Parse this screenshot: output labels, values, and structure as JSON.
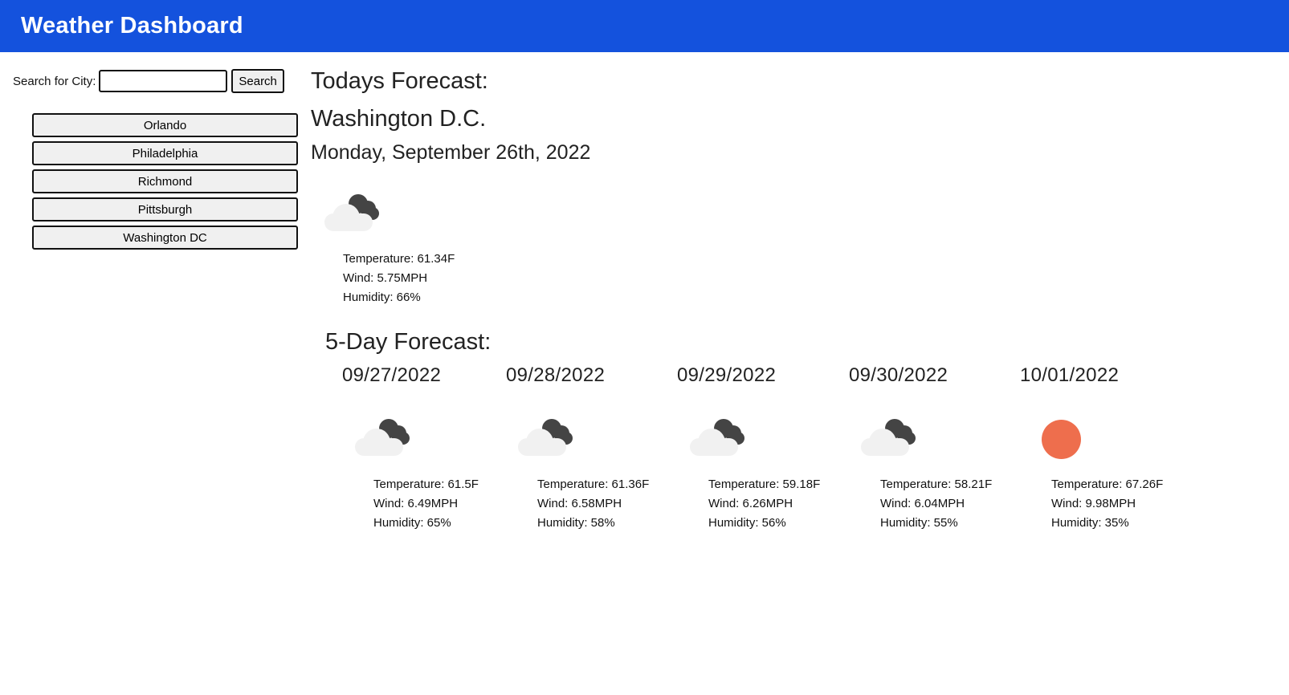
{
  "header": {
    "title": "Weather Dashboard"
  },
  "search": {
    "label": "Search for City:",
    "value": "",
    "button_label": "Search"
  },
  "history": [
    "Orlando",
    "Philadelphia",
    "Richmond",
    "Pittsburgh",
    "Washington DC"
  ],
  "today": {
    "heading": "Todays Forecast:",
    "city": "Washington D.C.",
    "date": "Monday, September 26th, 2022",
    "icon": "cloud-icon",
    "temperature": "Temperature: 61.34F",
    "wind": "Wind: 5.75MPH",
    "humidity": "Humidity: 66%"
  },
  "five_day": {
    "heading": "5-Day Forecast:",
    "days": [
      {
        "date": "09/27/2022",
        "icon": "cloud-icon",
        "temperature": "Temperature: 61.5F",
        "wind": "Wind: 6.49MPH",
        "humidity": "Humidity: 65%"
      },
      {
        "date": "09/28/2022",
        "icon": "cloud-icon",
        "temperature": "Temperature: 61.36F",
        "wind": "Wind: 6.58MPH",
        "humidity": "Humidity: 58%"
      },
      {
        "date": "09/29/2022",
        "icon": "cloud-icon",
        "temperature": "Temperature: 59.18F",
        "wind": "Wind: 6.26MPH",
        "humidity": "Humidity: 56%"
      },
      {
        "date": "09/30/2022",
        "icon": "cloud-icon",
        "temperature": "Temperature: 58.21F",
        "wind": "Wind: 6.04MPH",
        "humidity": "Humidity: 55%"
      },
      {
        "date": "10/01/2022",
        "icon": "sun-icon",
        "temperature": "Temperature: 67.26F",
        "wind": "Wind: 9.98MPH",
        "humidity": "Humidity: 35%"
      }
    ]
  },
  "colors": {
    "header_bg": "#1452dd",
    "sun": "#ee6e4d",
    "cloud_dark": "#444444",
    "cloud_light": "#f1f1f1"
  }
}
